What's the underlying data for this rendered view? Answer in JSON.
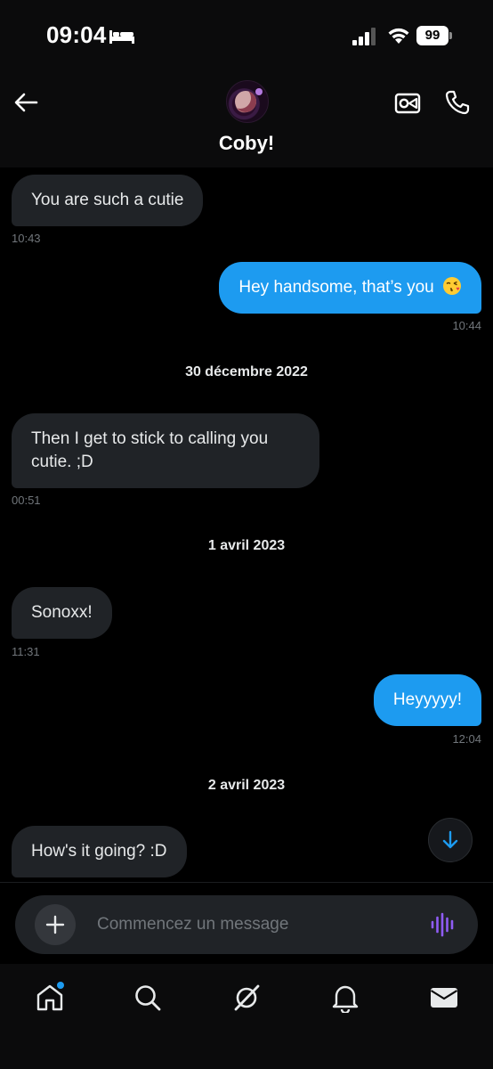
{
  "status_bar": {
    "time": "09:04",
    "battery": "99"
  },
  "header": {
    "contact_name": "Coby!"
  },
  "messages": [
    {
      "direction": "in",
      "text": "You are such a cutie",
      "time": "10:43"
    },
    {
      "direction": "out",
      "text": "Hey handsome, that’s you",
      "emoji": "face-blowing-kiss",
      "time": "10:44"
    },
    {
      "direction": "in",
      "text": "Then I get to stick to calling you cutie. ;D",
      "time": "00:51"
    },
    {
      "direction": "in",
      "text": "Sonoxx!",
      "time": "11:31"
    },
    {
      "direction": "out",
      "text": "Heyyyyy!",
      "time": "12:04"
    },
    {
      "direction": "in",
      "text": "How's it going? :D",
      "time": ""
    }
  ],
  "date_separators": [
    "30 décembre 2022",
    "1 avril 2023",
    "2 avril 2023"
  ],
  "composer": {
    "placeholder": "Commencez un message"
  },
  "nav": {
    "items": [
      "home-icon",
      "search-icon",
      "grok-icon",
      "notifications-icon",
      "messages-icon"
    ],
    "home_has_notification": true
  },
  "colors": {
    "accent": "#1d9bf0",
    "incoming_bubble": "#202327",
    "background": "#000000",
    "voice_icon": "#8f5cf5"
  }
}
